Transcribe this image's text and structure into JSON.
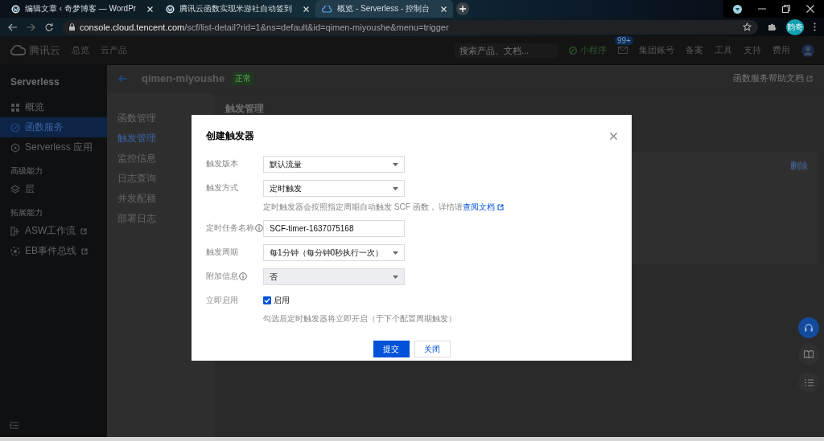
{
  "browser": {
    "tabs": [
      {
        "title": "编辑文章 ‹ 奇梦博客 — WordPr",
        "selected": false
      },
      {
        "title": "腾讯云函数实现米游社自动签到",
        "selected": false
      },
      {
        "title": "概览 - Serverless - 控制台",
        "selected": true
      }
    ],
    "url_host": "console.cloud.tencent.com",
    "url_path": "/scf/list-detail?rid=1&ns=default&id=qimen-miyoushe&menu=trigger",
    "profile": "韵奇"
  },
  "console_nav": {
    "logo": "腾讯云",
    "links": [
      "总览",
      "云产品"
    ],
    "search_placeholder": "搜索产品、文档...",
    "mini_program": "小程序",
    "mail_badge": "99+",
    "menus": [
      "集团账号",
      "备案",
      "工具",
      "支持",
      "费用"
    ]
  },
  "sidebar": {
    "title": "Serverless",
    "items": [
      {
        "kind": "item",
        "label": "概览",
        "selected": false,
        "external": false
      },
      {
        "kind": "item",
        "label": "函数服务",
        "selected": true,
        "external": false
      },
      {
        "kind": "item",
        "label": "Serverless 应用",
        "selected": false,
        "external": false
      },
      {
        "kind": "section",
        "label": "高级能力"
      },
      {
        "kind": "item",
        "label": "层",
        "selected": false,
        "external": false
      },
      {
        "kind": "section",
        "label": "拓展能力"
      },
      {
        "kind": "item",
        "label": "ASW工作流",
        "selected": false,
        "external": true
      },
      {
        "kind": "item",
        "label": "EB事件总线",
        "selected": false,
        "external": true
      }
    ]
  },
  "function": {
    "name": "qimen-miyoushe",
    "status": "正常",
    "help_link": "函数服务帮助文档"
  },
  "sub_nav": [
    {
      "label": "函数管理",
      "selected": false
    },
    {
      "label": "触发管理",
      "selected": true
    },
    {
      "label": "监控信息",
      "selected": false
    },
    {
      "label": "日志查询",
      "selected": false
    },
    {
      "label": "并发配额",
      "selected": false
    },
    {
      "label": "部署日志",
      "selected": false
    }
  ],
  "content": {
    "title": "触发管理",
    "card_action": "删除"
  },
  "dialog": {
    "title": "创建触发器",
    "fields": [
      {
        "kind": "select",
        "label": "触发版本",
        "info": false,
        "value": "默认流量",
        "disabled": false
      },
      {
        "kind": "select",
        "label": "触发方式",
        "info": false,
        "value": "定时触发",
        "disabled": false,
        "hint": "定时触发器会按照指定周期自动触发 SCF 函数， 详情请",
        "hint_link": "查阅文档"
      },
      {
        "kind": "input",
        "label": "定时任务名称",
        "info": true,
        "value": "SCF-timer-1637075168"
      },
      {
        "kind": "select",
        "label": "触发周期",
        "info": false,
        "value": "每1分钟（每分钟0秒执行一次）",
        "disabled": false
      },
      {
        "kind": "select",
        "label": "附加信息",
        "info": true,
        "value": "否",
        "disabled": true
      },
      {
        "kind": "checkbox",
        "label": "立即启用",
        "info": false,
        "value": "启用",
        "checked": true,
        "hint": "勾选后定时触发器将立即开启（于下个配置周期触发）"
      }
    ],
    "buttons": [
      {
        "label": "提交",
        "kind": "primary"
      },
      {
        "label": "关闭",
        "kind": "default"
      }
    ]
  }
}
